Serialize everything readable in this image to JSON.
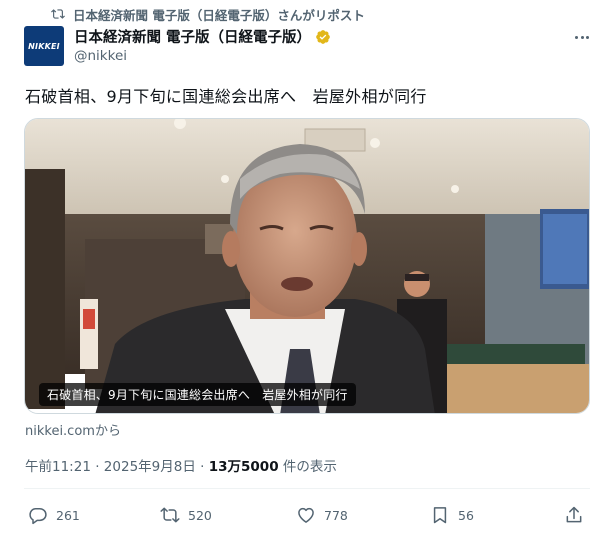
{
  "repost": {
    "icon": "repost-icon",
    "text": "日本経済新聞 電子版（日経電子版）さんがリポスト"
  },
  "author": {
    "avatar_text": "NIKKEI",
    "name": "日本経済新聞 電子版（日経電子版）",
    "handle": "@nikkei",
    "verified_icon": "verified-badge-icon",
    "verified_color": "#e2b719"
  },
  "menu": {
    "icon": "more-options-icon"
  },
  "tweet": {
    "text": "石破首相、9月下旬に国連総会出席へ　岩屋外相が同行"
  },
  "card": {
    "caption": "石破首相、9月下旬に国連総会出席へ　岩屋外相が同行",
    "source": "nikkei.comから"
  },
  "meta": {
    "time": "午前11:21",
    "separator": "·",
    "date": "2025年9月8日",
    "views_count": "13万5000",
    "views_suffix": "件の表示"
  },
  "actions": {
    "reply": {
      "icon": "reply-icon",
      "count": "261"
    },
    "repost": {
      "icon": "repost-icon",
      "count": "520"
    },
    "like": {
      "icon": "heart-icon",
      "count": "778"
    },
    "bookmark": {
      "icon": "bookmark-icon",
      "count": "56"
    },
    "share": {
      "icon": "share-icon"
    }
  },
  "colors": {
    "text_secondary": "#536471",
    "text_primary": "#0f1419",
    "brand": "#0d3b78"
  }
}
